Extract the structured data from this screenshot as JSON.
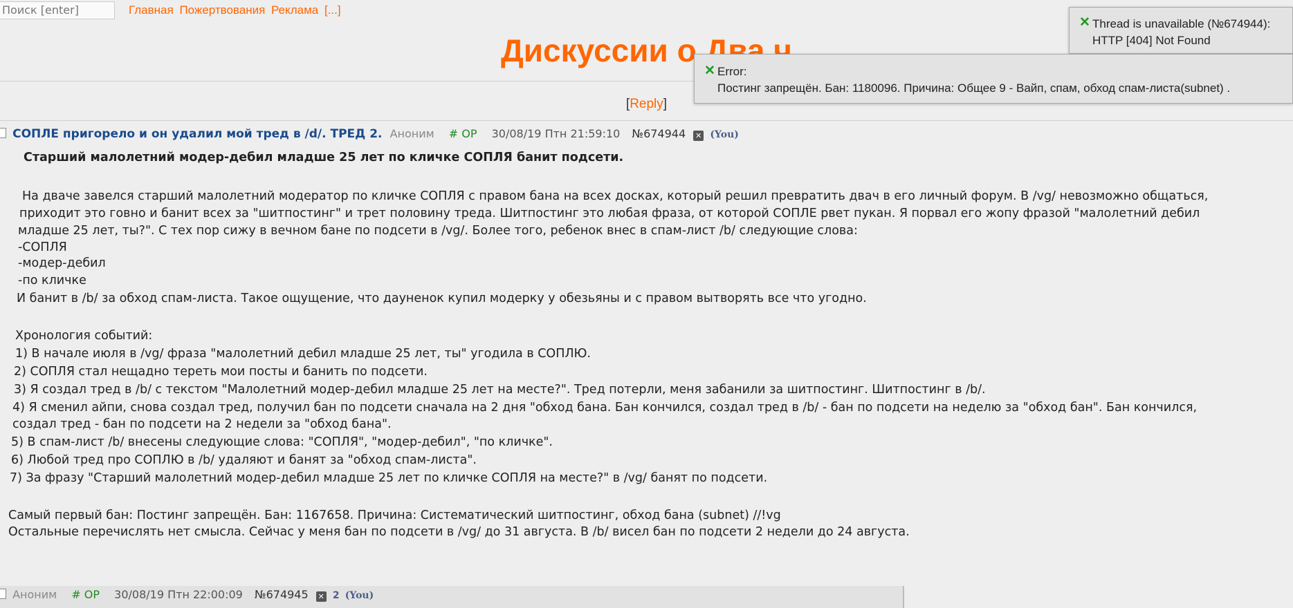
{
  "topbar": {
    "search_placeholder": "Поиск [enter]",
    "nav": [
      "Главная",
      "Пожертвования",
      "Реклама",
      "[...]"
    ]
  },
  "board_title": "Дискуссии о Два.ч",
  "reply_link": {
    "open": "[",
    "label": "Reply",
    "close": "]"
  },
  "op_post": {
    "subject": "СОПЛЕ пригорело и он удалил мой тред в /d/. ТРЕД 2.",
    "name": "Аноним",
    "op_mark": "# OP",
    "date": "30/08/19 Птн 21:59:10",
    "number": "№674944",
    "you": "(You)",
    "body": {
      "headline": "Старший малолетний модер-дебил младше 25 лет по кличке СОПЛЯ банит подсети.",
      "p1": "На дваче завелся старший малолетний модератор по кличке СОПЛЯ с правом бана на всех досках, который решил превратить двач в его личный форум. В /vg/ невозможно общаться,",
      "p2": "приходит это говно и банит всех за \"шитпостинг\" и трет половину треда. Шитпостинг это любая фраза, от которой СОПЛЕ рвет пукан. Я порвал его жопу фразой \"малолетний дебил",
      "p3": "младше 25 лет, ты?\". С тех пор сижу в вечном бане по подсети в /vg/. Более того, ребенок внес в спам-лист /b/ следующие слова:",
      "spam_words": [
        "-СОПЛЯ",
        "-модер-дебил",
        "-по кличке"
      ],
      "p4": "И банит в /b/ за обход спам-листа. Такое ощущение, что дауненок купил модерку у обезьяны и с правом вытворять все что угодно.",
      "chrono_title": "Хронология событий:",
      "chrono": [
        "1) В начале июля в /vg/ фраза \"малолетний дебил младше 25 лет, ты\" угодила в СОПЛЮ.",
        "2) СОПЛЯ стал нещадно тереть мои посты и банить по подсети.",
        "3) Я создал тред в /b/ с текстом \"Малолетний модер-дебил младше 25 лет на месте?\". Тред потерли, меня забанили за шитпостинг. Шитпостинг в /b/.",
        "4) Я сменил айпи, снова создал тред, получил бан по подсети сначала на 2 дня \"обход бана. Бан кончился, создал тред в /b/ - бан по подсети на неделю за \"обход бан\". Бан кончился,",
        "создал тред - бан по подсети на 2 недели за \"обход бана\".",
        "5) В спам-лист /b/ внесены следующие слова: \"СОПЛЯ\", \"модер-дебил\", \"по кличке\".",
        "6) Любой тред про СОПЛЮ в /b/ удаляют и банят за \"обход спам-листа\".",
        "7) За фразу \"Старший малолетний модер-дебил младше 25 лет по кличке СОПЛЯ на месте?\" в /vg/ банят по подсети."
      ],
      "p5": "Самый первый бан: Постинг запрещён. Бан: 1167658. Причина: Систематический шитпостинг, обход бана (subnet) //!vg",
      "p6": "Остальные перечислять нет смысла. Сейчас у меня бан по подсети в /vg/ до 31 августа. В /b/ висел бан по подсети 2 недели до 24 августа."
    }
  },
  "reply_post": {
    "name": "Аноним",
    "op_mark": "# OP",
    "date": "30/08/19 Птн 22:00:09",
    "number": "№674945",
    "count": "2",
    "you": "(You)"
  },
  "notices": {
    "not_found": {
      "line1": "Thread is unavailable (№674944):",
      "line2": "HTTP [404] Not Found"
    },
    "error": {
      "line1": "Error:",
      "line2": "Постинг запрещён. Бан: 1180096. Причина: Общее 9 - Вайп, спам, обход спам-листа(subnet) ."
    }
  },
  "icons": {
    "notice_close": "✕",
    "hide_post": "✕"
  },
  "colors": {
    "accent": "#ff6600",
    "subject": "#1a4b8c",
    "op": "#228b22",
    "you": "#4c5e89"
  }
}
